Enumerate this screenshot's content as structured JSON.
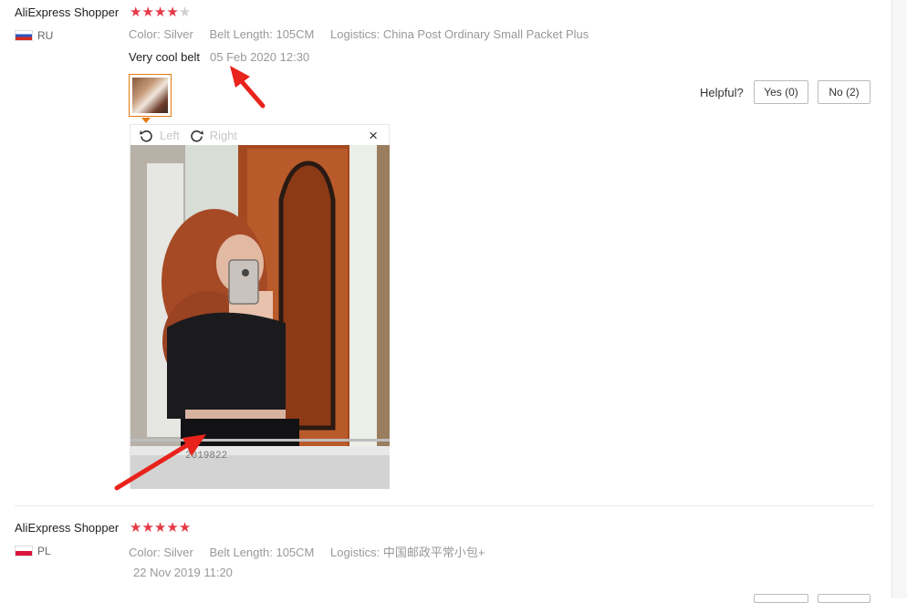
{
  "reviews": [
    {
      "user": "AliExpress Shopper",
      "rating": 4,
      "country": "RU",
      "attrs": [
        {
          "key": "Color:",
          "value": "Silver"
        },
        {
          "key": "Belt Length:",
          "value": "105CM"
        },
        {
          "key": "Logistics:",
          "value": "China Post Ordinary Small Packet Plus"
        }
      ],
      "text": "Very cool belt",
      "date": "05 Feb 2020 12:30",
      "helpful_label": "Helpful?",
      "yes_label": "Yes (0)",
      "no_label": "No (2)"
    },
    {
      "user": "AliExpress Shopper",
      "rating": 5,
      "country": "PL",
      "attrs": [
        {
          "key": "Color:",
          "value": "Silver"
        },
        {
          "key": "Belt Length:",
          "value": "105CM"
        },
        {
          "key": "Logistics:",
          "value": "中国邮政平常小包+"
        }
      ],
      "date": "22 Nov 2019 11:20"
    }
  ],
  "viewer": {
    "left_label": "Left",
    "right_label": "Right",
    "close_glyph": "×",
    "photo_caption": "2019822"
  },
  "colors": {
    "star": "#e63946",
    "thumb_border": "#e47911",
    "annotation_arrow": "#e8231c"
  }
}
